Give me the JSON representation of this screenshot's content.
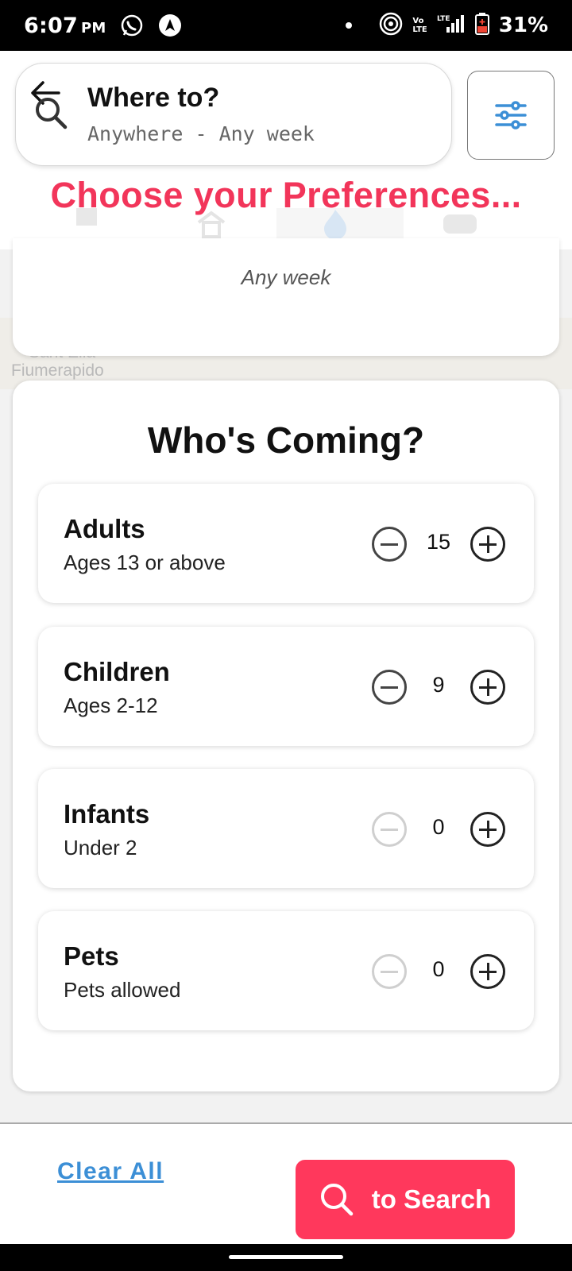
{
  "status_bar": {
    "time": "6:07",
    "ampm": "PM",
    "battery": "31%",
    "network": "LTE"
  },
  "header": {
    "title": "Where to?",
    "subtitle": "Anywhere - Any week",
    "banner": "Choose your Preferences..."
  },
  "background": {
    "map_text_1": "Sant Elia",
    "map_text_2": "Fiumerapido"
  },
  "previous_section": {
    "summary": "Any week"
  },
  "guests": {
    "title": "Who's Coming?",
    "items": [
      {
        "label": "Adults",
        "description": "Ages 13 or above",
        "count": "15",
        "minus_enabled": true
      },
      {
        "label": "Children",
        "description": "Ages 2-12",
        "count": "9",
        "minus_enabled": true
      },
      {
        "label": "Infants",
        "description": "Under 2",
        "count": "0",
        "minus_enabled": false
      },
      {
        "label": "Pets",
        "description": "Pets allowed",
        "count": "0",
        "minus_enabled": false
      }
    ]
  },
  "footer": {
    "clear_label": "Clear All",
    "search_label": "to Search"
  },
  "colors": {
    "accent": "#ff385c",
    "banner": "#f2355a",
    "link": "#3c8fd6",
    "filter_icon": "#3c8fd6"
  },
  "icons": [
    "back-arrow-icon",
    "search-icon",
    "filter-sliders-icon",
    "minus-icon",
    "plus-icon",
    "whatsapp-icon",
    "navigation-icon",
    "hotspot-icon",
    "signal-icon",
    "battery-icon"
  ]
}
